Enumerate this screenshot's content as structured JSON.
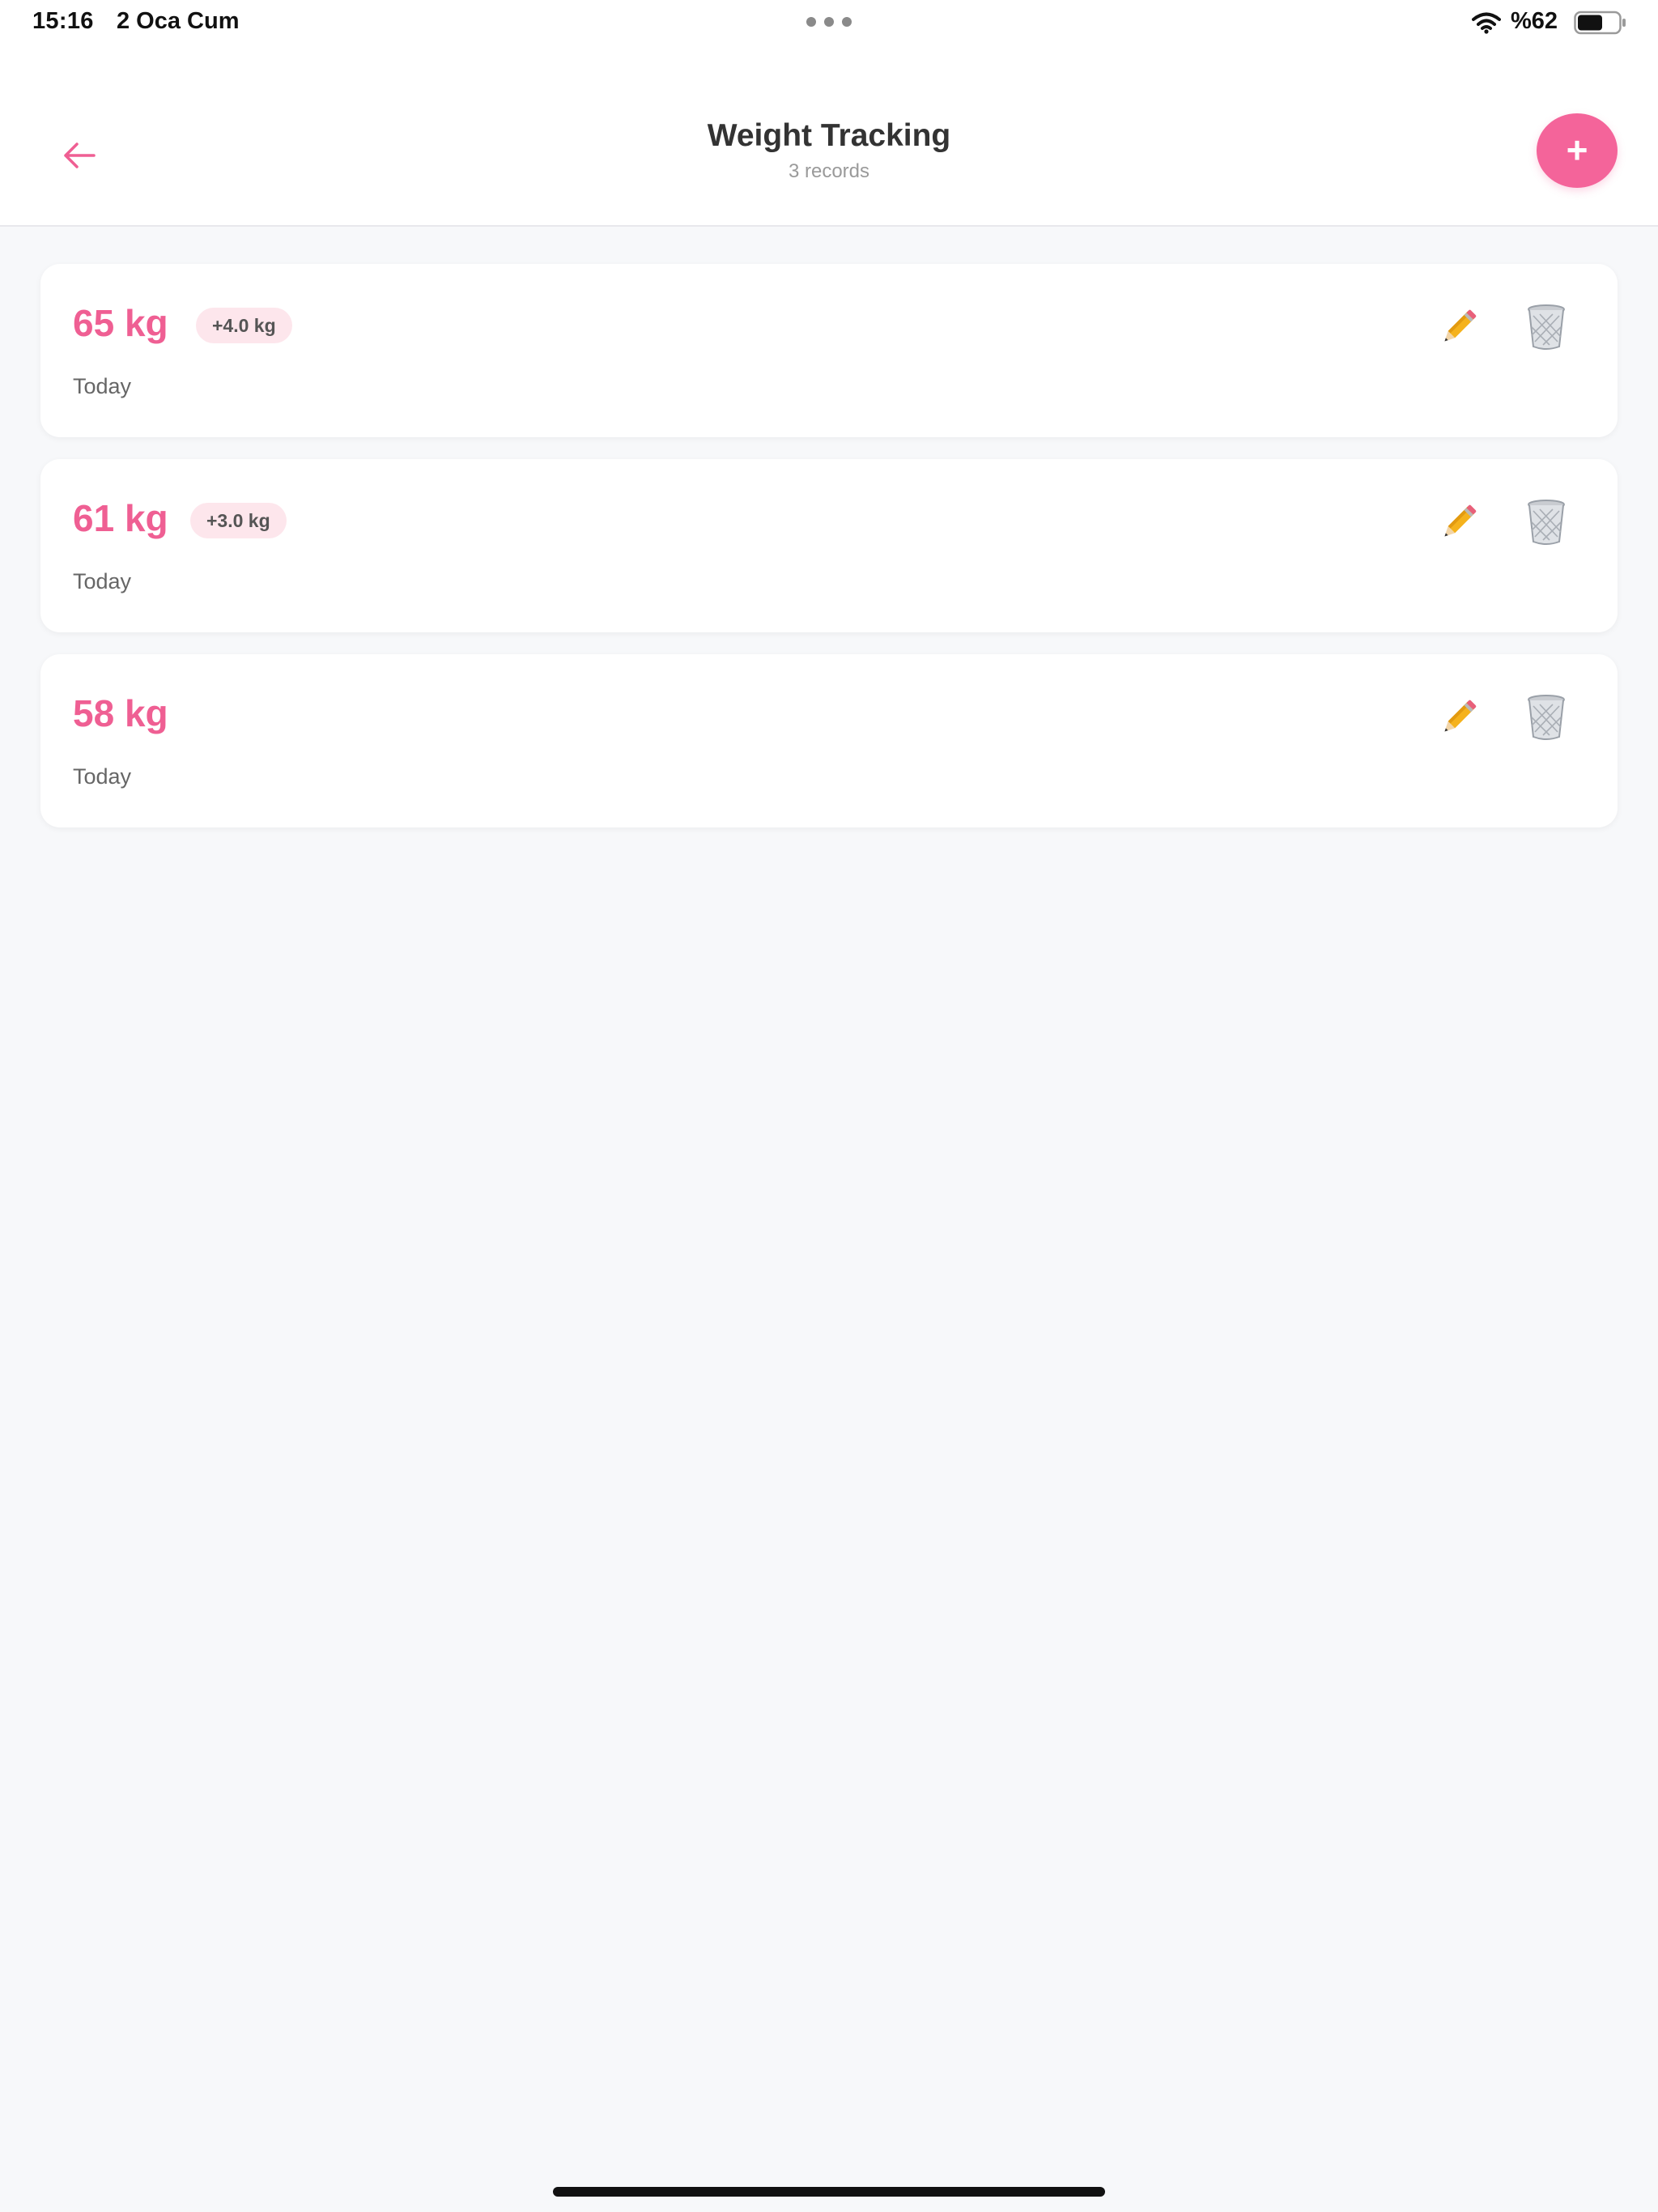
{
  "status_bar": {
    "time": "15:16",
    "date": "2 Oca Cum",
    "battery_percent": "%62",
    "battery_level": 0.62
  },
  "header": {
    "title": "Weight Tracking",
    "subtitle": "3 records",
    "back_icon": "arrow-left-icon",
    "add_label": "+"
  },
  "records": [
    {
      "weight": "65 kg",
      "change": "+4.0 kg",
      "date": "Today"
    },
    {
      "weight": "61 kg",
      "change": "+3.0 kg",
      "date": "Today"
    },
    {
      "weight": "58 kg",
      "change": "",
      "date": "Today"
    }
  ],
  "icons": {
    "edit": "pencil-icon",
    "delete": "trash-icon"
  },
  "colors": {
    "accent": "#f4649a",
    "weight_text": "#ef5f93",
    "badge_bg": "#fde6ec",
    "background": "#f7f8fa",
    "card": "#ffffff"
  }
}
